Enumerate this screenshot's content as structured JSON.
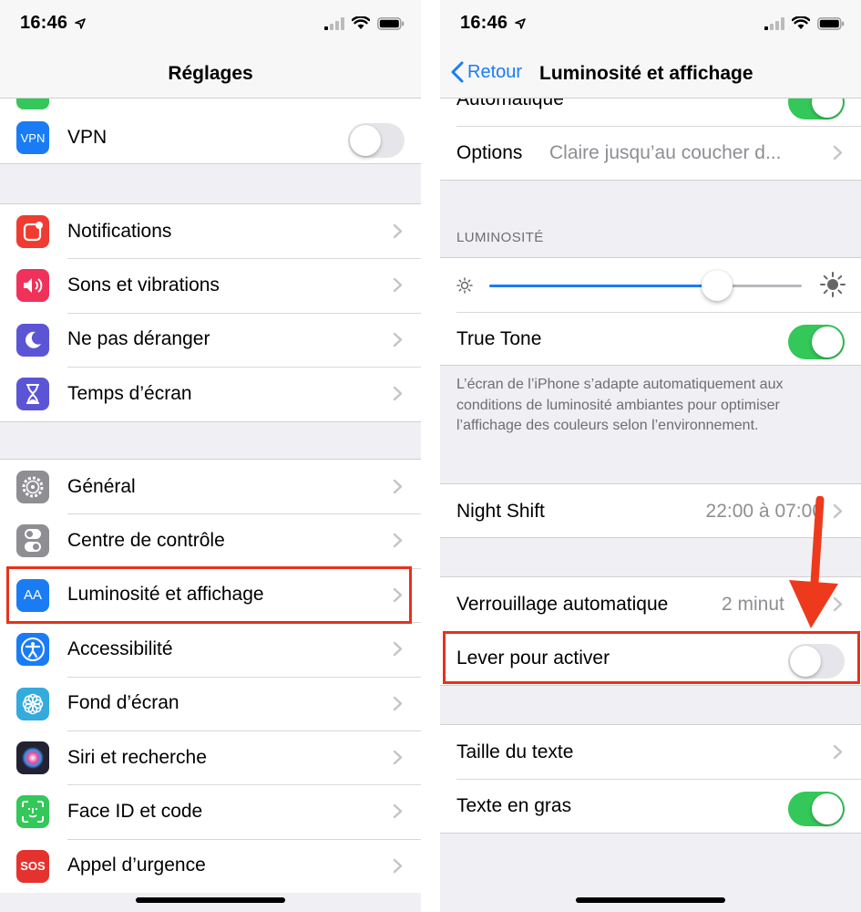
{
  "status_bar": {
    "time": "16:46"
  },
  "left": {
    "nav_title": "Réglages",
    "vpn": {
      "label": "VPN",
      "icon_text": "VPN",
      "icon": "vpn-icon",
      "toggle_on": false
    },
    "group1": [
      {
        "label": "Notifications",
        "icon": "notifications-icon",
        "color": "#ef3b31"
      },
      {
        "label": "Sons et vibrations",
        "icon": "speaker-icon",
        "color": "#f0315a"
      },
      {
        "label": "Ne pas déranger",
        "icon": "moon-icon",
        "color": "#5b55d6"
      },
      {
        "label": "Temps d’écran",
        "icon": "hourglass-icon",
        "color": "#5b55d6"
      }
    ],
    "group2": [
      {
        "label": "Général",
        "icon": "gear-icon",
        "color": "#8e8e93"
      },
      {
        "label": "Centre de contrôle",
        "icon": "switches-icon",
        "color": "#8e8e93"
      },
      {
        "label": "Luminosité et affichage",
        "icon": "text-size-icon",
        "icon_text": "AA",
        "color": "#1a7cf5"
      },
      {
        "label": "Accessibilité",
        "icon": "accessibility-icon",
        "color": "#1a7cf5"
      },
      {
        "label": "Fond d’écran",
        "icon": "flower-icon",
        "color": "#35aadc"
      },
      {
        "label": "Siri et recherche",
        "icon": "siri-icon",
        "color": "#222233"
      },
      {
        "label": "Face ID et code",
        "icon": "face-id-icon",
        "color": "#34c759"
      },
      {
        "label": "Appel d’urgence",
        "icon": "sos-icon",
        "icon_text": "SOS",
        "color": "#e5322e"
      }
    ]
  },
  "right": {
    "back_label": "Retour",
    "nav_title": "Luminosité et affichage",
    "automatic_label": "Automatique",
    "automatic_on": true,
    "options_label": "Options",
    "options_value": "Claire jusqu’au coucher d...",
    "brightness_header": "LUMINOSITÉ",
    "brightness_level": 0.73,
    "true_tone_label": "True Tone",
    "true_tone_on": true,
    "true_tone_footer": "L’écran de l’iPhone s’adapte automatiquement aux conditions de luminosité ambiantes pour optimiser l’affichage des couleurs selon l’environnement.",
    "night_shift_label": "Night Shift",
    "night_shift_value": "22:00 à 07:00",
    "auto_lock_label": "Verrouillage automatique",
    "auto_lock_value": "2 minut",
    "raise_label": "Lever pour activer",
    "raise_on": false,
    "text_size_label": "Taille du texte",
    "bold_text_label": "Texte en gras",
    "bold_text_on": true
  },
  "colors": {
    "accent": "#1a7cf5",
    "toggle_on": "#34c759",
    "highlight": "#e8311b"
  }
}
